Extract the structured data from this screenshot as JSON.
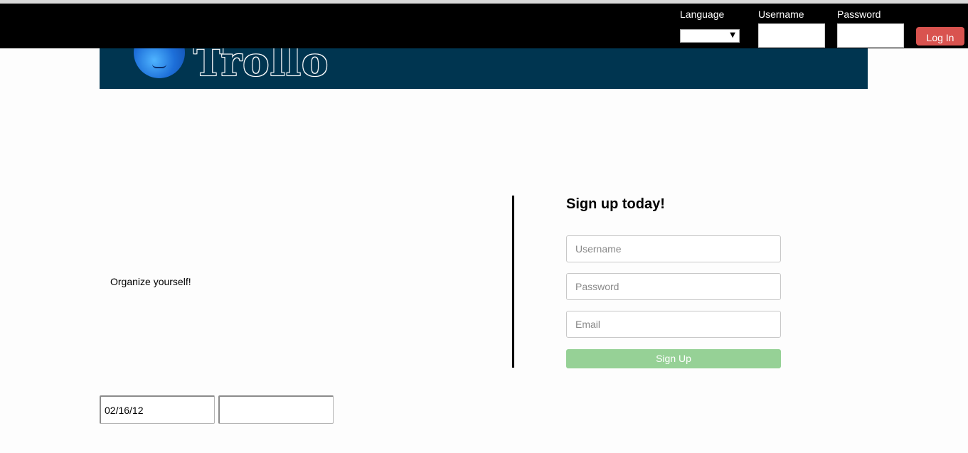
{
  "topbar": {
    "language_label": "Language",
    "language_value": "",
    "username_label": "Username",
    "password_label": "Password",
    "username_value": "",
    "password_value": "",
    "login_label": "Log In"
  },
  "brand": {
    "name": "Trollo",
    "banner_color": "#003550",
    "logo_icon": "blue-troll-face-icon"
  },
  "main": {
    "tagline": "Organize yourself!"
  },
  "signup": {
    "title": "Sign up today!",
    "username_placeholder": "Username",
    "password_placeholder": "Password",
    "email_placeholder": "Email",
    "button_label": "Sign Up",
    "button_color": "#96d196"
  },
  "dates": {
    "start_value": "02/16/12",
    "end_value": ""
  }
}
